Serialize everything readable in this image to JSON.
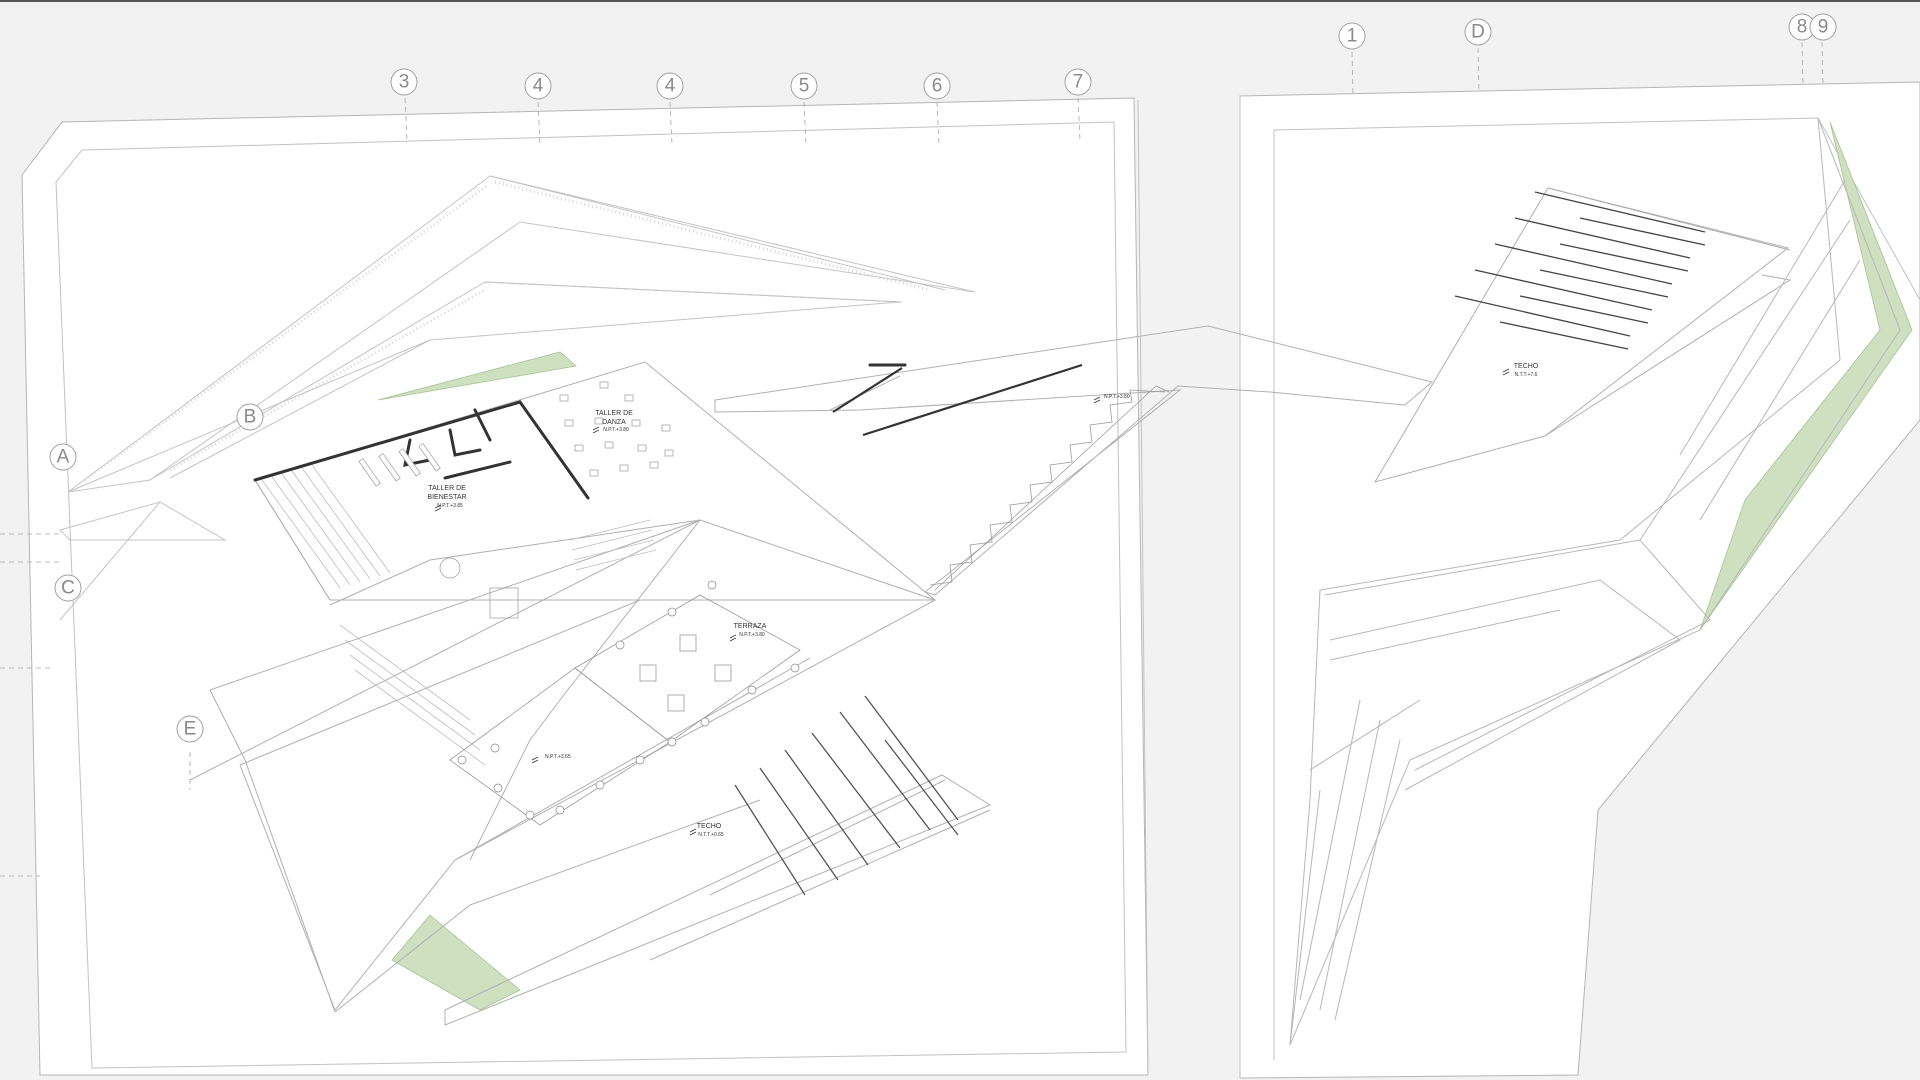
{
  "grid_axes": {
    "columns": [
      "3",
      "4",
      "4",
      "5",
      "6",
      "7",
      "1",
      "D",
      "8",
      "9"
    ],
    "rows": [
      "A",
      "B",
      "C",
      "E"
    ]
  },
  "rooms": {
    "taller_danza": {
      "line1": "TALLER DE",
      "line2": "DANZA",
      "level": "N.P.T.+3.80"
    },
    "taller_bienestar": {
      "line1": "TALLER DE",
      "line2": "BIENESTAR",
      "level": "N.P.T.+3.85"
    },
    "terraza": {
      "name": "TERRAZA",
      "level": "N.P.T.+3.80"
    },
    "techo_left": {
      "name": "TECHO",
      "level": "N.T.T.+0.65"
    },
    "techo_right": {
      "name": "TECHO",
      "level": "N.T.T.+7.6"
    }
  },
  "levels": {
    "ramp_top": "N.P.T.+3.80",
    "terrace_lower": "N.P.T.+3.65"
  },
  "colors": {
    "background": "#f2f2f2",
    "sheet": "#ffffff",
    "line": "#b5b5b5",
    "dark_wall": "#333333",
    "vegetation": "#cfe0c0",
    "axis": "#9a9a9a"
  }
}
